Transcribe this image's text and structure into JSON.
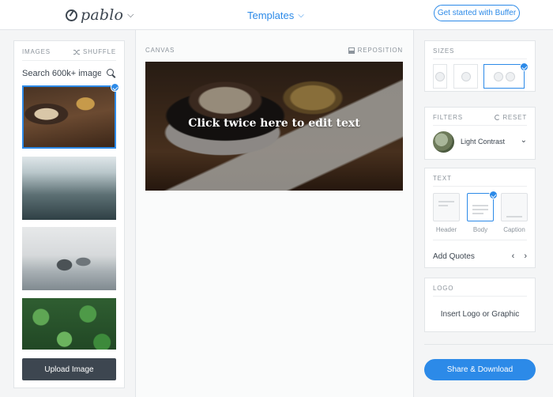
{
  "header": {
    "logo_text": "pablo",
    "templates_label": "Templates",
    "cta_label": "Get started with Buffer"
  },
  "images_panel": {
    "title": "IMAGES",
    "shuffle_label": "SHUFFLE",
    "search_placeholder": "Search 600k+ images",
    "upload_label": "Upload Image",
    "thumbnails": [
      "coffee-cup-and-bell",
      "foggy-forest",
      "misty-rocky-coast",
      "green-leaves"
    ],
    "selected_index": 0
  },
  "canvas": {
    "title": "CANVAS",
    "reposition_label": "REPOSITION",
    "overlay_text": "Click twice here to edit text"
  },
  "sizes": {
    "title": "SIZES",
    "options": [
      "pinterest",
      "instagram",
      "facebook-twitter"
    ],
    "selected": "facebook-twitter"
  },
  "filters": {
    "title": "FILTERS",
    "reset_label": "RESET",
    "selected": "Light Contrast"
  },
  "text": {
    "title": "TEXT",
    "options": [
      {
        "label": "Header"
      },
      {
        "label": "Body"
      },
      {
        "label": "Caption"
      }
    ],
    "selected": "Body",
    "add_quotes_label": "Add Quotes"
  },
  "logo": {
    "title": "LOGO",
    "insert_label": "Insert Logo or Graphic"
  },
  "share_label": "Share & Download",
  "colors": {
    "accent": "#2c8ae8",
    "dark": "#3d4650"
  }
}
